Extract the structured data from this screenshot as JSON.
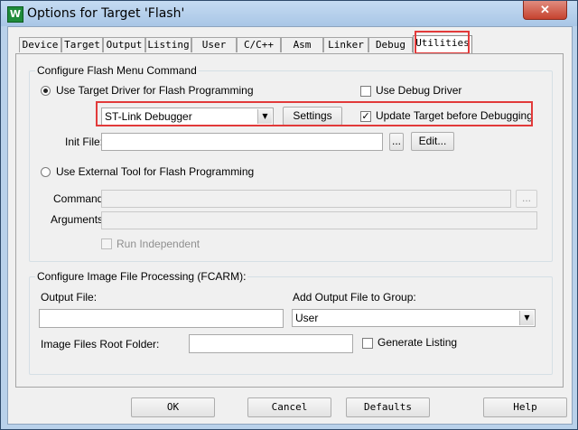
{
  "window": {
    "title": "Options for Target 'Flash'",
    "app_icon_glyph": "W",
    "close_glyph": "✕",
    "highlight_color": "#e23a3a"
  },
  "tabs": [
    {
      "label": "Device"
    },
    {
      "label": "Target"
    },
    {
      "label": "Output"
    },
    {
      "label": "Listing"
    },
    {
      "label": "User"
    },
    {
      "label": "C/C++"
    },
    {
      "label": "Asm"
    },
    {
      "label": "Linker"
    },
    {
      "label": "Debug"
    },
    {
      "label": "Utilities",
      "active": true
    }
  ],
  "flash_group": {
    "legend": "Configure Flash Menu Command",
    "use_target_driver_label": "Use Target Driver for Flash Programming",
    "use_debug_driver_label": "Use Debug Driver",
    "driver_select_value": "ST-Link Debugger",
    "settings_label": "Settings",
    "update_target_label": "Update Target before Debugging",
    "init_file_label": "Init File:",
    "init_file_value": "",
    "browse_label": "...",
    "edit_label": "Edit...",
    "use_external_tool_label": "Use External Tool for Flash Programming",
    "command_label": "Command:",
    "arguments_label": "Arguments:",
    "run_independent_label": "Run Independent"
  },
  "image_group": {
    "legend": "Configure Image File Processing (FCARM):",
    "output_file_label": "Output File:",
    "output_file_value": "",
    "add_output_label": "Add Output File  to Group:",
    "group_select_value": "User",
    "root_folder_label": "Image Files Root Folder:",
    "root_folder_value": "",
    "generate_listing_label": "Generate Listing"
  },
  "footer": {
    "ok_label": "OK",
    "cancel_label": "Cancel",
    "defaults_label": "Defaults",
    "help_label": "Help"
  }
}
